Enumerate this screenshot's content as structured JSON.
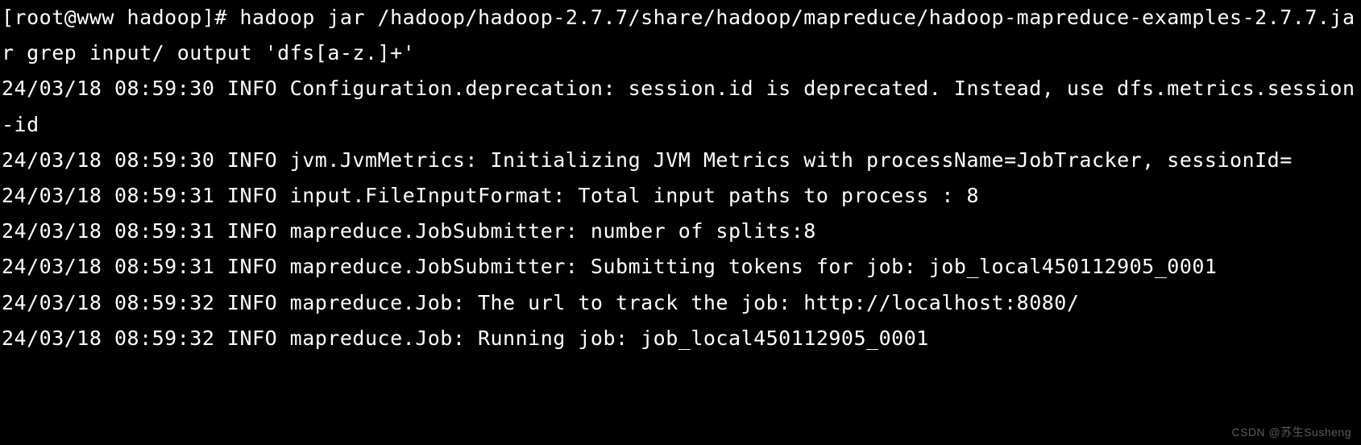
{
  "terminal": {
    "prompt": "[root@www hadoop]# ",
    "command": "hadoop jar /hadoop/hadoop-2.7.7/share/hadoop/mapreduce/hadoop-mapreduce-examples-2.7.7.jar grep input/ output 'dfs[a-z.]+'",
    "lines": [
      "24/03/18 08:59:30 INFO Configuration.deprecation: session.id is deprecated. Instead, use dfs.metrics.session-id",
      "24/03/18 08:59:30 INFO jvm.JvmMetrics: Initializing JVM Metrics with processName=JobTracker, sessionId=",
      "24/03/18 08:59:31 INFO input.FileInputFormat: Total input paths to process : 8",
      "24/03/18 08:59:31 INFO mapreduce.JobSubmitter: number of splits:8",
      "24/03/18 08:59:31 INFO mapreduce.JobSubmitter: Submitting tokens for job: job_local450112905_0001",
      "24/03/18 08:59:32 INFO mapreduce.Job: The url to track the job: http://localhost:8080/",
      "24/03/18 08:59:32 INFO mapreduce.Job: Running job: job_local450112905_0001"
    ]
  },
  "watermark": "CSDN @苏生Susheng"
}
